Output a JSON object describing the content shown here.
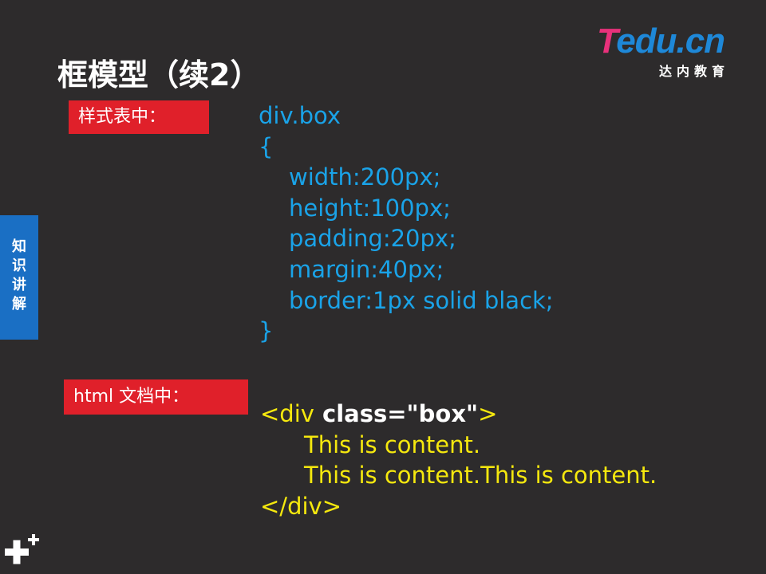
{
  "logo": {
    "brand_t": "T",
    "brand_rest": "edu.cn",
    "subtitle": "达内教育",
    "colors": {
      "t": "#e8317b",
      "rest": "#1e88d8"
    }
  },
  "slide": {
    "title": "框模型（续2）",
    "side_tab": "知识讲解",
    "css_label": "样式表中：",
    "html_label": "html 文档中："
  },
  "css_code": {
    "selector": "div.box",
    "open_brace": "{",
    "declarations": [
      "width:200px;",
      "height:100px;",
      "padding:20px;",
      "margin:40px;",
      "border:1px solid black;"
    ],
    "close_brace": "}"
  },
  "html_code": {
    "open_tag_start": "<div",
    "open_tag_attr": " class=\"box\"",
    "open_tag_end": ">",
    "content_lines": [
      "This is content.",
      "This is content.This is content."
    ],
    "close_tag": "</div>"
  },
  "colors": {
    "background": "#2d2b2c",
    "css_code": "#1aa3e8",
    "html_code": "#f5e80e",
    "label_bg": "#e0202a",
    "side_tab_bg": "#1a6fc4"
  },
  "icons": {
    "corner": "plus-icon"
  }
}
